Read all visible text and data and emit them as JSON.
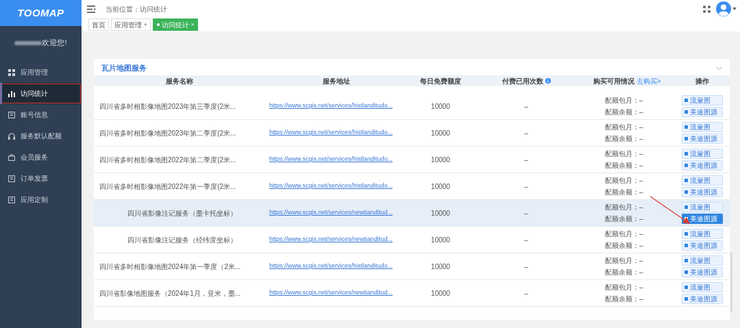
{
  "logo": "TOOMAP",
  "welcome": "欢迎您!",
  "sidebar": {
    "items": [
      {
        "label": "应用管理",
        "selected": false
      },
      {
        "label": "访问统计",
        "selected": true
      },
      {
        "label": "账号信息",
        "selected": false
      },
      {
        "label": "服务默认配额",
        "selected": false
      },
      {
        "label": "会员服务",
        "selected": false
      },
      {
        "label": "订单发票",
        "selected": false
      },
      {
        "label": "应用定制",
        "selected": false
      }
    ]
  },
  "breadcrumb": "当前位置：访问统计",
  "tabs": [
    {
      "label": "首页",
      "selected": false
    },
    {
      "label": "应用管理",
      "close": "×",
      "selected": false
    },
    {
      "label": "访问统计",
      "close": "×",
      "selected": true
    }
  ],
  "card": {
    "title": "瓦片地图服务",
    "columns": [
      "服务名称",
      "服务地址",
      "每日免费额度",
      "付费已用次数",
      "购买可用情况",
      "操作"
    ],
    "buy_link": "去购买>",
    "rows": [
      {
        "name": "四川省多时相影像地图2023年第三季度(2米...",
        "url": "https://www.scgis.net/services/histlanditudo...",
        "free": "10000",
        "paid": "–",
        "monthly": "配额包月：–",
        "balance": "配额余额：–",
        "actions": [
          {
            "label": "流量图",
            "selected": false
          },
          {
            "label": "美途图源",
            "selected": false
          }
        ],
        "hover": false
      },
      {
        "name": "四川省多时相影像地图2023年第二季度(2米...",
        "url": "https://www.scgis.net/services/histlanditudo...",
        "free": "10000",
        "paid": "–",
        "monthly": "配额包月：–",
        "balance": "配额余额：–",
        "actions": [
          {
            "label": "流量图",
            "selected": false
          },
          {
            "label": "美途图源",
            "selected": false
          }
        ],
        "hover": false
      },
      {
        "name": "四川省多时相影像地图2022年第二季度(2米...",
        "url": "https://www.scgis.net/services/histlanditudo...",
        "free": "10000",
        "paid": "–",
        "monthly": "配额包月：–",
        "balance": "配额余额：–",
        "actions": [
          {
            "label": "流量图",
            "selected": false
          },
          {
            "label": "美途图源",
            "selected": false
          }
        ],
        "hover": false
      },
      {
        "name": "四川省多时相影像地图2022年第一季度(2米...",
        "url": "https://www.scgis.net/services/histlanditudo...",
        "free": "10000",
        "paid": "–",
        "monthly": "配额包月：–",
        "balance": "配额余额：–",
        "actions": [
          {
            "label": "流量图",
            "selected": false
          },
          {
            "label": "美途图源",
            "selected": false
          }
        ],
        "hover": false
      },
      {
        "name": "四川省影像注记服务（墨卡托坐标）",
        "url": "https://www.scgis.net/services/newtianditud...",
        "free": "10000",
        "paid": "–",
        "monthly": "配额包月：–",
        "balance": "配额余额：–",
        "actions": [
          {
            "label": "流量图",
            "selected": false
          },
          {
            "label": "美途图源",
            "selected": true
          }
        ],
        "hover": true
      },
      {
        "name": "四川省影像注记服务（经纬度坐标）",
        "url": "https://www.scgis.net/services/newtianditud...",
        "free": "10000",
        "paid": "–",
        "monthly": "配额包月：–",
        "balance": "配额余额：–",
        "actions": [
          {
            "label": "流量图",
            "selected": false
          },
          {
            "label": "美途图源",
            "selected": false
          }
        ],
        "hover": false
      },
      {
        "name": "四川省多时相影像地图2024年第一季度（2米...",
        "url": "https://www.scgis.net/services/histlanditudo...",
        "free": "10000",
        "paid": "–",
        "monthly": "配额包月：–",
        "balance": "配额余额：–",
        "actions": [
          {
            "label": "流量图",
            "selected": false
          },
          {
            "label": "美途图源",
            "selected": false
          }
        ],
        "hover": false
      },
      {
        "name": "四川省影像地图服务（2024年1月，亚米，墨...",
        "url": "https://www.scgis.net/services/newtianditud...",
        "free": "10000",
        "paid": "–",
        "monthly": "配额包月：–",
        "balance": "配额余额：–",
        "actions": [
          {
            "label": "流量图",
            "selected": false
          },
          {
            "label": "美途图源",
            "selected": false
          }
        ],
        "hover": false
      }
    ]
  }
}
